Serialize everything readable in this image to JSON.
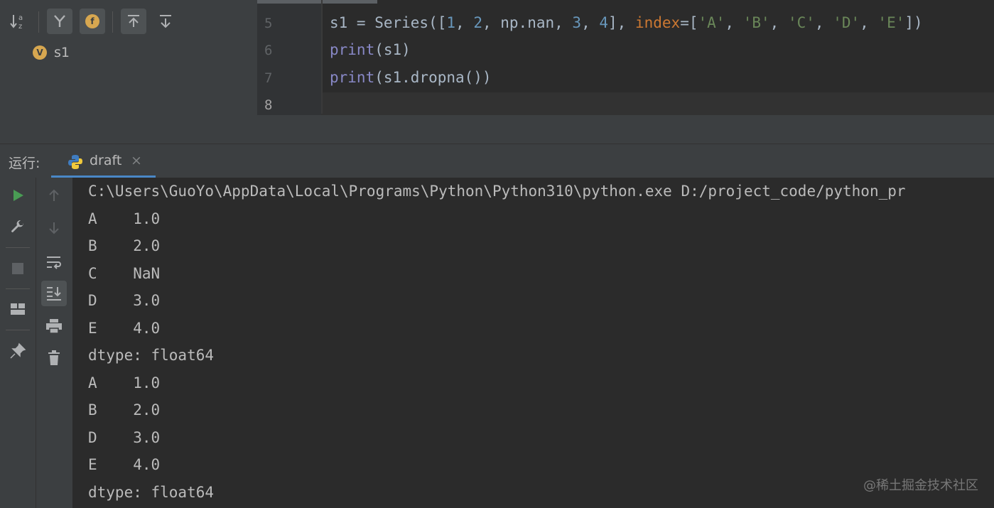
{
  "structure": {
    "variable_badge": "V",
    "variable_name": "s1",
    "toolbar_icons": [
      "sort-alpha-icon",
      "filter-icon",
      "field-icon",
      "expand-all-icon",
      "collapse-all-icon"
    ],
    "field_badge": "f"
  },
  "editor": {
    "lines": [
      {
        "num": "5",
        "tokens": [
          {
            "t": "s1 = Series([",
            "c": ""
          },
          {
            "t": "1",
            "c": "kw-num"
          },
          {
            "t": ", ",
            "c": ""
          },
          {
            "t": "2",
            "c": "kw-num"
          },
          {
            "t": ", np.nan, ",
            "c": ""
          },
          {
            "t": "3",
            "c": "kw-num"
          },
          {
            "t": ", ",
            "c": ""
          },
          {
            "t": "4",
            "c": "kw-num"
          },
          {
            "t": "], ",
            "c": ""
          },
          {
            "t": "index",
            "c": "kw-param"
          },
          {
            "t": "=[",
            "c": ""
          },
          {
            "t": "'A'",
            "c": "kw-str"
          },
          {
            "t": ", ",
            "c": ""
          },
          {
            "t": "'B'",
            "c": "kw-str"
          },
          {
            "t": ", ",
            "c": ""
          },
          {
            "t": "'C'",
            "c": "kw-str"
          },
          {
            "t": ", ",
            "c": ""
          },
          {
            "t": "'D'",
            "c": "kw-str"
          },
          {
            "t": ", ",
            "c": ""
          },
          {
            "t": "'E'",
            "c": "kw-str"
          },
          {
            "t": "])",
            "c": ""
          }
        ]
      },
      {
        "num": "6",
        "tokens": [
          {
            "t": "print",
            "c": "kw-fn"
          },
          {
            "t": "(s1)",
            "c": ""
          }
        ]
      },
      {
        "num": "7",
        "tokens": [
          {
            "t": "print",
            "c": "kw-fn"
          },
          {
            "t": "(s1.dropna())",
            "c": ""
          }
        ]
      },
      {
        "num": "8",
        "tokens": []
      }
    ]
  },
  "run": {
    "label": "运行:",
    "tab_label": "draft",
    "tab_close": "×",
    "console_lines": [
      "C:\\Users\\GuoYo\\AppData\\Local\\Programs\\Python\\Python310\\python.exe D:/project_code/python_pr",
      "A    1.0",
      "B    2.0",
      "C    NaN",
      "D    3.0",
      "E    4.0",
      "dtype: float64",
      "A    1.0",
      "B    2.0",
      "D    3.0",
      "E    4.0",
      "dtype: float64"
    ]
  },
  "watermark": "@稀土掘金技术社区",
  "colors": {
    "accent": "#4a88c7",
    "run_green": "#499c54",
    "badge": "#d7a750"
  }
}
